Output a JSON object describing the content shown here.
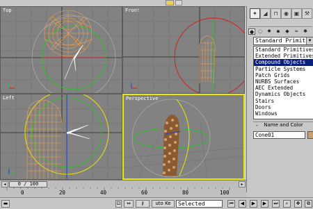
{
  "viewports": {
    "top": {
      "label": "Top"
    },
    "front": {
      "label": "Front"
    },
    "left": {
      "label": "Left"
    },
    "perspective": {
      "label": "Perspective"
    }
  },
  "command_panel": {
    "tabs": [
      "create-icon",
      "modify-icon",
      "hierarchy-icon",
      "motion-icon",
      "display-icon",
      "utilities-icon"
    ],
    "categories": [
      "geometry-icon",
      "shapes-icon",
      "lights-icon",
      "cameras-icon",
      "helpers-icon",
      "space-warps-icon",
      "systems-icon"
    ],
    "dropdown_value": "Standard Primitiv",
    "object_types": [
      "Standard Primitives",
      "Extended Primitives",
      "Compound Objects",
      "Particle Systems",
      "Patch Grids",
      "NURBS Surfaces",
      "AEC Extended",
      "Dynamics Objects",
      "Stairs",
      "Doors",
      "Windows"
    ],
    "selected_object_type": "Compound Objects",
    "rollout_title": "Name and Color",
    "rollout_sign": "-",
    "object_name": "Cone01",
    "object_color": "#c8a070"
  },
  "time_slider": {
    "value": "0 / 100"
  },
  "track_bar": {
    "ticks": [
      "0",
      "20",
      "40",
      "60",
      "80",
      "100"
    ]
  },
  "status_bar": {
    "auto_key_label": "uto Ke",
    "set_key_value": "Selected"
  },
  "colors": {
    "viewport_bg": "#828282",
    "active_viewport_border": "#e8e800",
    "wireframe": "#f0a050",
    "highlight": "#0a1e7c"
  }
}
